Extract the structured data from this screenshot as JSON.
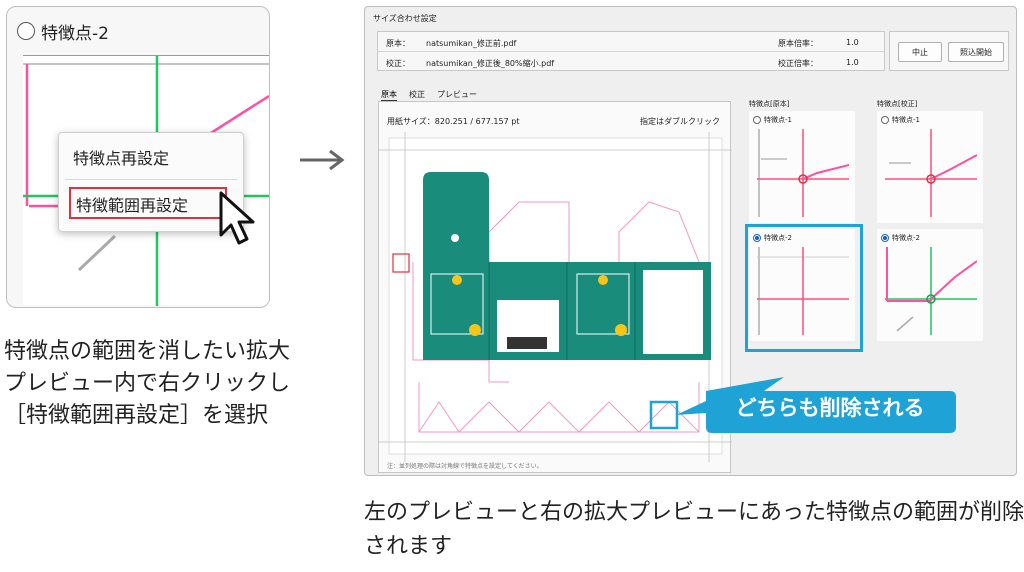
{
  "zoom_panel": {
    "header_label": "特徴点-2",
    "menu_item_1": "特徴点再設定",
    "menu_item_2": "特徴範囲再設定"
  },
  "left_caption": "特徴点の範囲を消したい拡大プレビュー内で右クリックし［特徴範囲再設定］を選択",
  "dialog": {
    "title": "サイズ合わせ設定",
    "original_label": "原本：",
    "original_file": "natsumikan_修正前.pdf",
    "original_scale_label": "原本倍率：",
    "original_scale": "1.0",
    "corrected_label": "校正：",
    "corrected_file": "natsumikan_修正後_80%縮小.pdf",
    "corrected_scale_label": "校正倍率：",
    "corrected_scale": "1.0",
    "stop_button": "中止",
    "start_button": "照込開始",
    "tabs": [
      "原本",
      "校正",
      "プレビュー"
    ],
    "paper_size": "用紙サイズ：820.251 / 677.157 pt",
    "double_click_hint": "指定はダブルクリック",
    "note": "注：並列処理の際は対角線で特徴点を設定してください。",
    "fp_original_title": "特徴点[原本]",
    "fp_corrected_title": "特徴点[校正]",
    "fp1_label": "特徴点-1",
    "fp2_label": "特徴点-2"
  },
  "callout_text": "どちらも削除される",
  "right_caption": "左のプレビューと右の拡大プレビューにあった特徴点の範囲が削除されます",
  "colors": {
    "accent_blue": "#1fa3d6",
    "highlight_red": "#e0313f",
    "package_teal": "#1a8c7c",
    "guide_pink": "#ff4fa0",
    "guide_green": "#22c55e"
  }
}
